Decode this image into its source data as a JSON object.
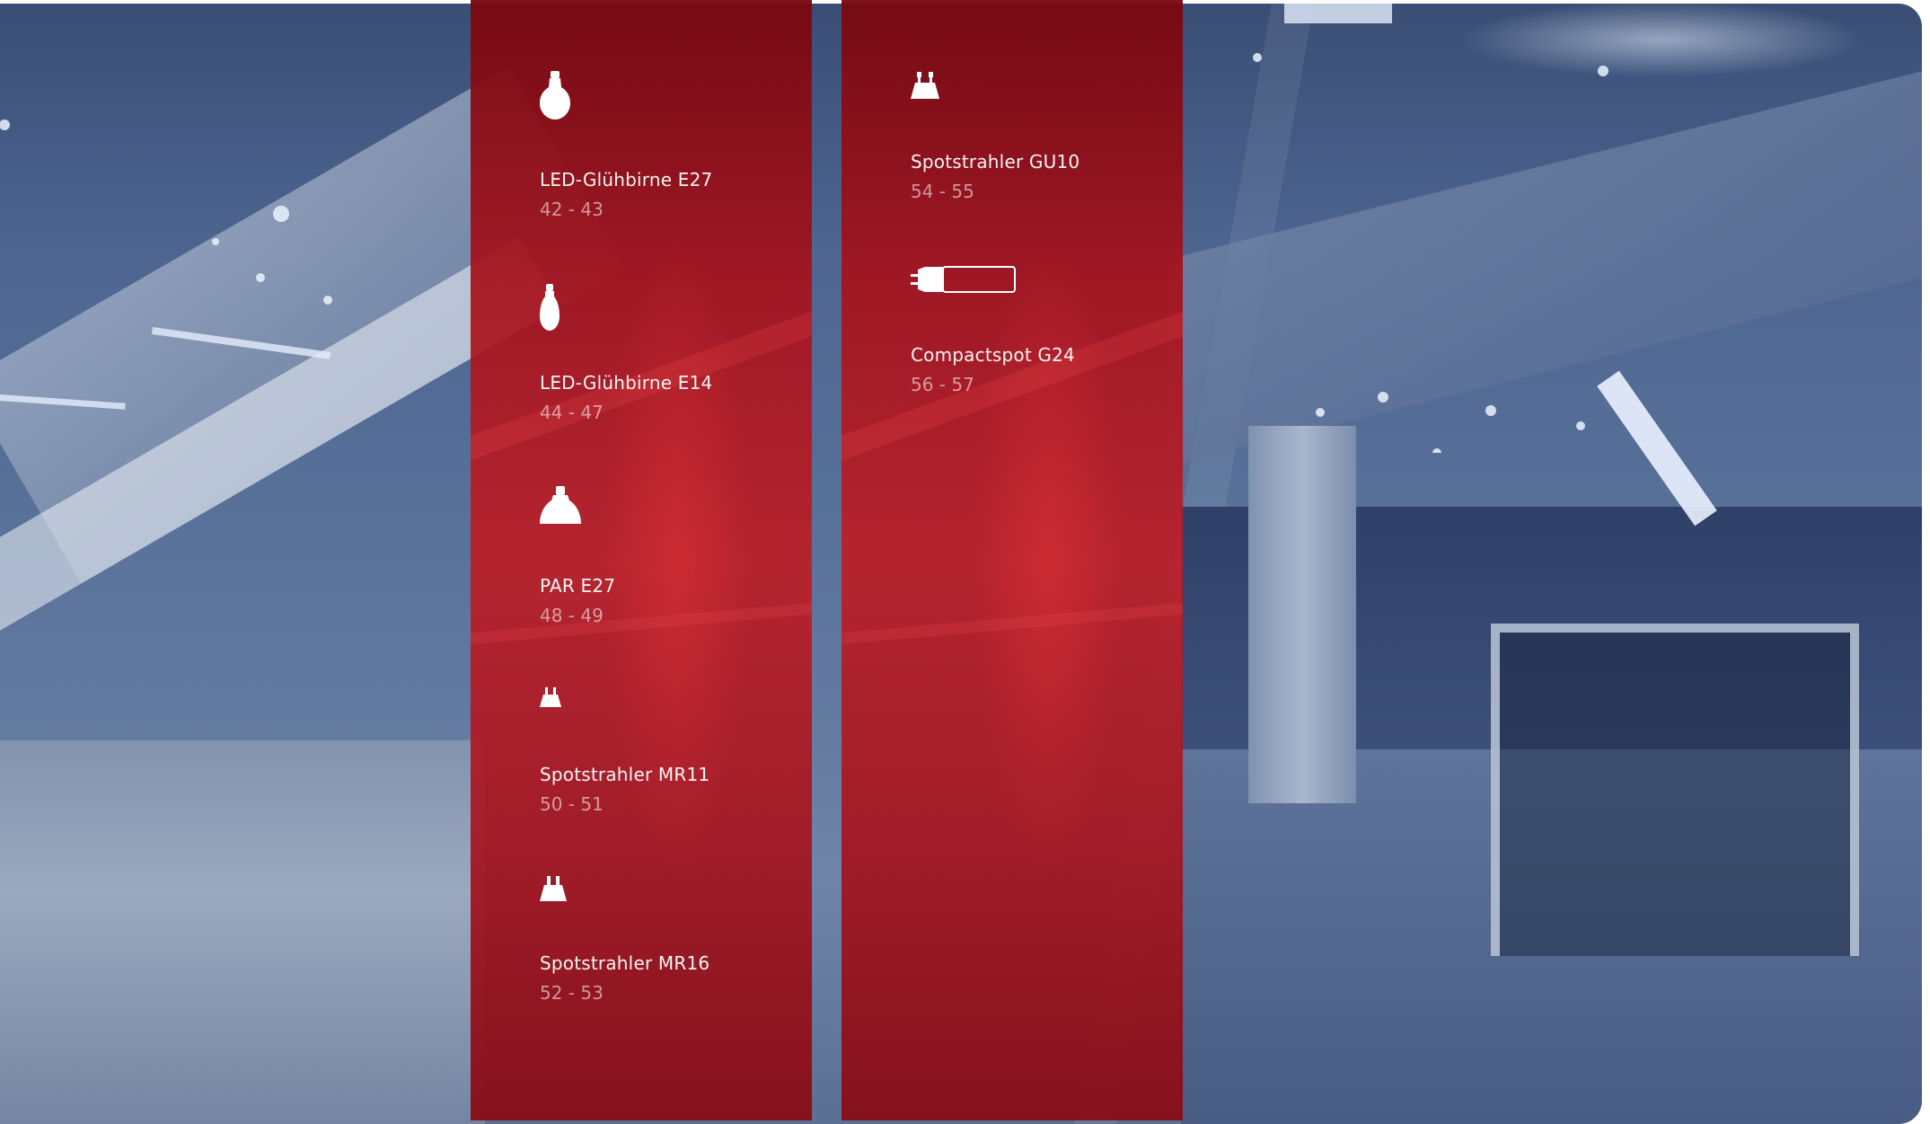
{
  "panels": [
    {
      "items": [
        {
          "icon": "bulb-e27-icon",
          "title": "LED-Glühbirne E27",
          "pages": "42 - 43"
        },
        {
          "icon": "bulb-e14-icon",
          "title": "LED-Glühbirne E14",
          "pages": "44 - 47"
        },
        {
          "icon": "par-lamp-icon",
          "title": "PAR E27",
          "pages": "48 - 49"
        },
        {
          "icon": "spot-mr11-icon",
          "title": "Spotstrahler MR11",
          "pages": "50 - 51"
        },
        {
          "icon": "spot-mr16-icon",
          "title": "Spotstrahler MR16",
          "pages": "52 - 53"
        }
      ]
    },
    {
      "items": [
        {
          "icon": "spot-gu10-icon",
          "title": "Spotstrahler GU10",
          "pages": "54 - 55"
        },
        {
          "icon": "compactspot-g24-icon",
          "title": "Compactspot G24",
          "pages": "56 - 57"
        }
      ]
    }
  ],
  "colors": {
    "panel_red": "#b0141e",
    "background_blue": "#4d6590",
    "text": "#ffffff",
    "page_text": "rgba(255,255,255,0.55)"
  }
}
